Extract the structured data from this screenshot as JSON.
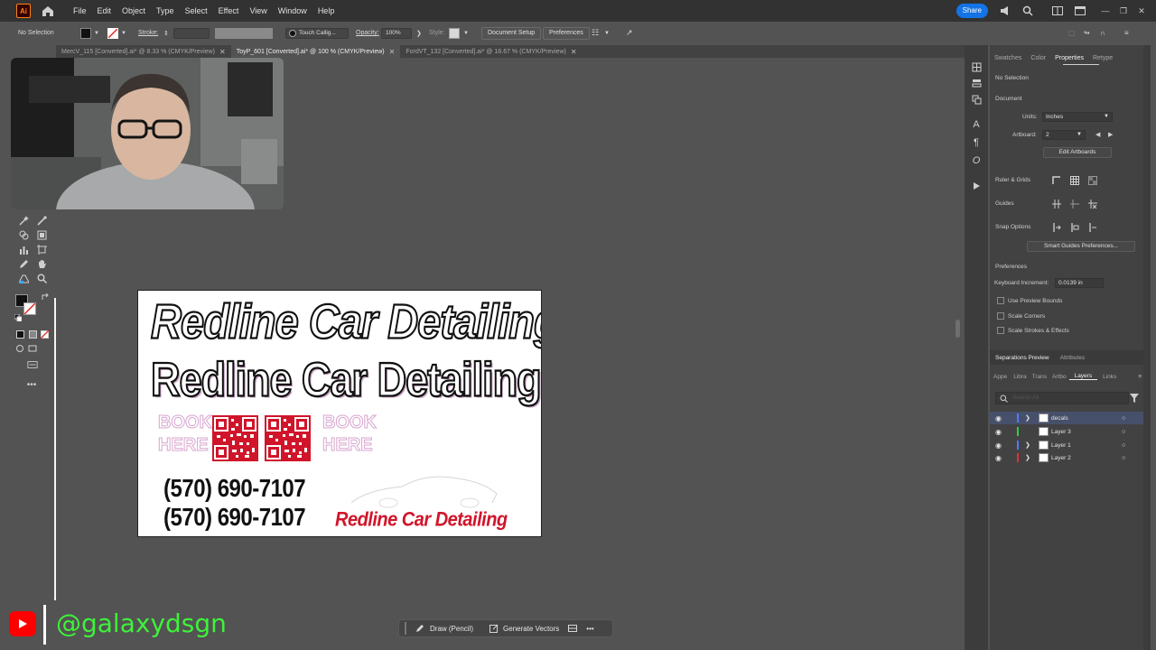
{
  "menubar": {
    "logo_text": "Ai",
    "items": [
      "File",
      "Edit",
      "Object",
      "Type",
      "Select",
      "Effect",
      "View",
      "Window",
      "Help"
    ],
    "share_label": "Share"
  },
  "control_bar": {
    "selection": "No Selection",
    "stroke_label": "Stroke:",
    "brush_label": "Touch Callig...",
    "opacity_label": "Opacity:",
    "opacity_value": "100%",
    "style_label": "Style:",
    "document_setup": "Document Setup",
    "preferences": "Preferences"
  },
  "tabs": [
    {
      "label": "MercV_115 [Converted].ai* @ 8.33 % (CMYK/Preview)"
    },
    {
      "label": "ToyP_601 [Converted].ai* @ 100 % (CMYK/Preview)"
    },
    {
      "label": "FordVT_132 [Converted].ai* @ 16.67 % (CMYK/Preview)"
    }
  ],
  "artboard": {
    "headline_italic": "Redline Car Detailing",
    "headline_bold": "Redline Car Detailing",
    "book_here": [
      "BOOK",
      "HERE"
    ],
    "phone": "(570) 690-7107",
    "logo_text": "Redline Car Detailing"
  },
  "right_panel": {
    "tabs": [
      "Swatches",
      "Color",
      "Properties",
      "Retype"
    ],
    "no_selection": "No Selection",
    "document": "Document",
    "units_label": "Units:",
    "units_value": "Inches",
    "artboard_label": "Artboard:",
    "artboard_value": "2",
    "edit_artboards": "Edit Artboards",
    "ruler_grids": "Ruler & Grids",
    "guides": "Guides",
    "snap_options": "Snap Options",
    "smart_guides": "Smart Guides Preferences...",
    "preferences": "Preferences",
    "keyboard_increment_label": "Keyboard Increment:",
    "keyboard_increment_value": "0.0139 in",
    "checkboxes": [
      "Use Preview Bounds",
      "Scale Corners",
      "Scale Strokes & Effects"
    ],
    "sep_tabs": [
      "Separations Preview",
      "Attributes"
    ],
    "layer_tabs": [
      "Appe",
      "Libra",
      "Trans",
      "Artbo",
      "Layers",
      "Links"
    ],
    "search_placeholder": "Search All",
    "layers": [
      {
        "name": "decals",
        "color": "#4f7cff"
      },
      {
        "name": "Layer 3",
        "color": "#3ac94a"
      },
      {
        "name": "Layer 1",
        "color": "#4f7cff"
      },
      {
        "name": "Layer 2",
        "color": "#e0313a"
      }
    ]
  },
  "bottom_bar": {
    "draw_label": "Draw (Pencil)",
    "vectors_label": "Generate Vectors"
  },
  "overlay": {
    "handle": "@galaxydsgn"
  }
}
